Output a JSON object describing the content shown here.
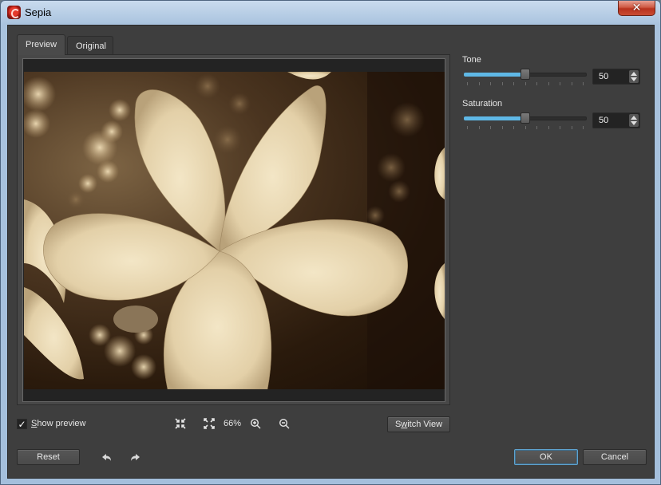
{
  "window": {
    "title": "Sepia",
    "close_label": "✕"
  },
  "tabs": [
    {
      "label": "Preview",
      "active": true
    },
    {
      "label": "Original",
      "active": false
    }
  ],
  "preview": {
    "image_description": "Sepia-toned plumeria flower",
    "show_preview": {
      "checked": true,
      "check_glyph": "✓",
      "label_first": "S",
      "label_rest": "how preview"
    },
    "zoom_level": "66%",
    "tools": [
      "fit-to-window",
      "actual-size",
      "zoom-in",
      "zoom-out"
    ],
    "switch_view": {
      "label_pre": "S",
      "label_u": "w",
      "label_post": "itch View"
    }
  },
  "params": [
    {
      "label": "Tone",
      "value": "50",
      "min": 0,
      "max": 100,
      "fraction": 0.5
    },
    {
      "label": "Saturation",
      "value": "50",
      "min": 0,
      "max": 100,
      "fraction": 0.5
    }
  ],
  "footer": {
    "reset_label": "Reset",
    "undo_icon": "undo-arrow",
    "redo_icon": "redo-arrow",
    "ok_label": "OK",
    "cancel_label": "Cancel"
  },
  "colors": {
    "accent": "#5fb8e6",
    "panel_bg": "#3e3e3e",
    "ok_border": "#5fa3cf"
  }
}
